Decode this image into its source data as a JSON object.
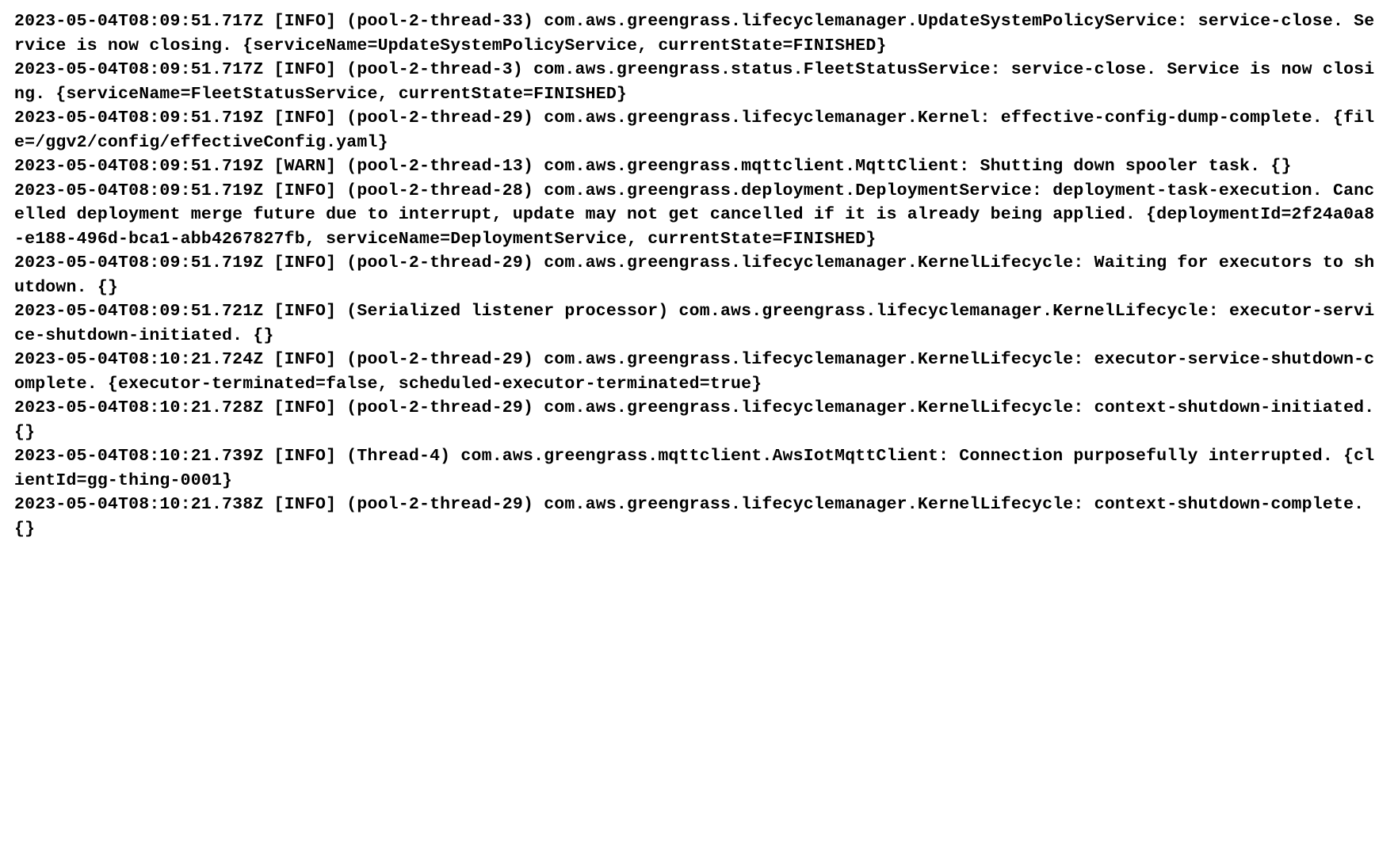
{
  "log_entries": [
    {
      "timestamp": "2023-05-04T08:09:51.717Z",
      "level": "[INFO]",
      "thread": "(pool-2-thread-33)",
      "logger": "com.aws.greengrass.lifecyclemanager.UpdateSystemPolicyService:",
      "event": "service-close.",
      "message": "Service is now closing.",
      "context": "{serviceName=UpdateSystemPolicyService, currentState=FINISHED}"
    },
    {
      "timestamp": "2023-05-04T08:09:51.717Z",
      "level": "[INFO]",
      "thread": "(pool-2-thread-3)",
      "logger": "com.aws.greengrass.status.FleetStatusService:",
      "event": "service-close.",
      "message": "Service is now closing.",
      "context": "{serviceName=FleetStatusService, currentState=FINISHED}"
    },
    {
      "timestamp": "2023-05-04T08:09:51.719Z",
      "level": "[INFO]",
      "thread": "(pool-2-thread-29)",
      "logger": "com.aws.greengrass.lifecyclemanager.Kernel:",
      "event": "effective-config-dump-complete.",
      "message": "",
      "context": "{file=/ggv2/config/effectiveConfig.yaml}"
    },
    {
      "timestamp": "2023-05-04T08:09:51.719Z",
      "level": "[WARN]",
      "thread": "(pool-2-thread-13)",
      "logger": "com.aws.greengrass.mqttclient.MqttClient:",
      "event": "",
      "message": "Shutting down spooler task.",
      "context": "{}"
    },
    {
      "timestamp": "2023-05-04T08:09:51.719Z",
      "level": "[INFO]",
      "thread": "(pool-2-thread-28)",
      "logger": "com.aws.greengrass.deployment.DeploymentService:",
      "event": "deployment-task-execution.",
      "message": "Cancelled deployment merge future due to interrupt, update may not get cancelled if it is already being applied.",
      "context": "{deploymentId=2f24a0a8-e188-496d-bca1-abb4267827fb, serviceName=DeploymentService, currentState=FINISHED}"
    },
    {
      "timestamp": "2023-05-04T08:09:51.719Z",
      "level": "[INFO]",
      "thread": "(pool-2-thread-29)",
      "logger": "com.aws.greengrass.lifecyclemanager.KernelLifecycle:",
      "event": "",
      "message": "Waiting for executors to shutdown.",
      "context": "{}"
    },
    {
      "timestamp": "2023-05-04T08:09:51.721Z",
      "level": "[INFO]",
      "thread": "(Serialized listener processor)",
      "logger": "com.aws.greengrass.lifecyclemanager.KernelLifecycle:",
      "event": "executor-service-shutdown-initiated.",
      "message": "",
      "context": "{}"
    },
    {
      "timestamp": "2023-05-04T08:10:21.724Z",
      "level": "[INFO]",
      "thread": "(pool-2-thread-29)",
      "logger": "com.aws.greengrass.lifecyclemanager.KernelLifecycle:",
      "event": "executor-service-shutdown-complete.",
      "message": "",
      "context": "{executor-terminated=false, scheduled-executor-terminated=true}"
    },
    {
      "timestamp": "2023-05-04T08:10:21.728Z",
      "level": "[INFO]",
      "thread": "(pool-2-thread-29)",
      "logger": "com.aws.greengrass.lifecyclemanager.KernelLifecycle:",
      "event": "context-shutdown-initiated.",
      "message": "",
      "context": "{}"
    },
    {
      "timestamp": "2023-05-04T08:10:21.739Z",
      "level": "[INFO]",
      "thread": "(Thread-4)",
      "logger": "com.aws.greengrass.mqttclient.AwsIotMqttClient:",
      "event": "",
      "message": "Connection purposefully interrupted.",
      "context": "{clientId=gg-thing-0001}"
    },
    {
      "timestamp": "2023-05-04T08:10:21.738Z",
      "level": "[INFO]",
      "thread": "(pool-2-thread-29)",
      "logger": "com.aws.greengrass.lifecyclemanager.KernelLifecycle:",
      "event": "context-shutdown-complete.",
      "message": "",
      "context": "{}"
    }
  ]
}
